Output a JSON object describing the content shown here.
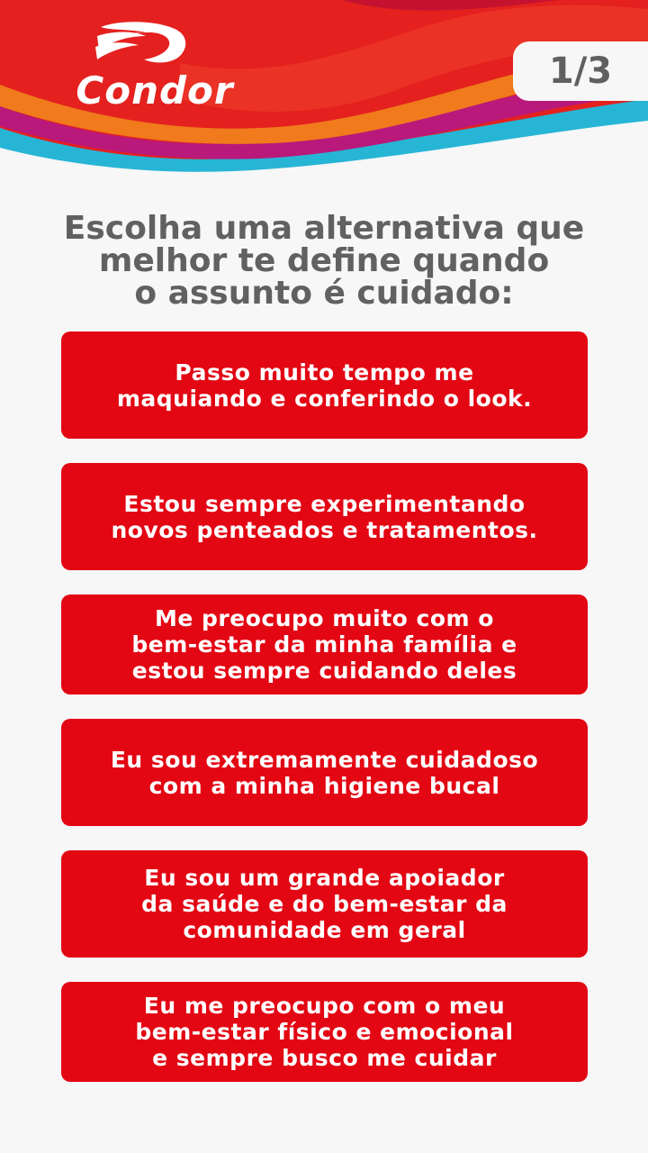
{
  "header": {
    "brand": "Condor",
    "page_counter": "1/3",
    "colors": {
      "red": "#e4211f",
      "orange": "#f07a1c",
      "magenta": "#b8197a",
      "cyan": "#27b5d6",
      "white": "#ffffff"
    }
  },
  "question": {
    "text": "Escolha uma alternativa que\nmelhor te define quando\n o assunto é cuidado:"
  },
  "options": [
    {
      "label": "Passo muito tempo me\nmaquiando e conferindo o look."
    },
    {
      "label": "Estou sempre experimentando\nnovos penteados e tratamentos."
    },
    {
      "label": "Me preocupo muito com o\nbem-estar da minha família e\n estou sempre cuidando deles"
    },
    {
      "label": "Eu sou extremamente cuidadoso\ncom a minha higiene bucal"
    },
    {
      "label": "Eu sou um grande apoiador\n da saúde e do bem-estar da\ncomunidade em geral"
    },
    {
      "label": "Eu me preocupo com o meu\nbem-estar físico e emocional\ne sempre busco me cuidar"
    }
  ]
}
